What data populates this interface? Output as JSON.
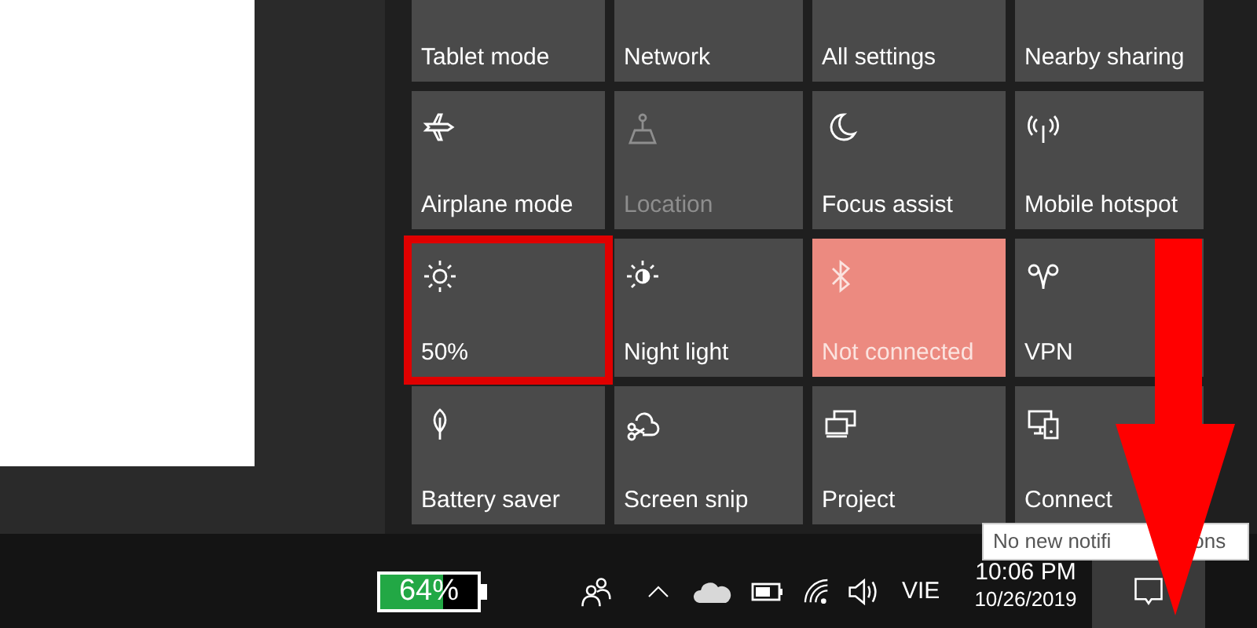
{
  "quick_actions": [
    {
      "label": "Tablet mode",
      "on": false,
      "disabled": false
    },
    {
      "label": "Network",
      "on": false,
      "disabled": false
    },
    {
      "label": "All settings",
      "on": false,
      "disabled": false
    },
    {
      "label": "Nearby sharing",
      "on": false,
      "disabled": false
    },
    {
      "label": "Airplane mode",
      "on": false,
      "disabled": false
    },
    {
      "label": "Location",
      "on": false,
      "disabled": true
    },
    {
      "label": "Focus assist",
      "on": false,
      "disabled": false
    },
    {
      "label": "Mobile hotspot",
      "on": false,
      "disabled": false
    },
    {
      "label": "50%",
      "on": false,
      "disabled": false
    },
    {
      "label": "Night light",
      "on": false,
      "disabled": false
    },
    {
      "label": "Not connected",
      "on": true,
      "disabled": false
    },
    {
      "label": "VPN",
      "on": false,
      "disabled": false
    },
    {
      "label": "Battery saver",
      "on": false,
      "disabled": false
    },
    {
      "label": "Screen snip",
      "on": false,
      "disabled": false
    },
    {
      "label": "Project",
      "on": false,
      "disabled": false
    },
    {
      "label": "Connect",
      "on": false,
      "disabled": false
    }
  ],
  "tooltip": {
    "parts": [
      "No new notifi",
      "ons"
    ]
  },
  "taskbar": {
    "battery_widget": {
      "reading": "64%",
      "level": 0.64
    },
    "language": "VIE",
    "time": "10:06 PM",
    "date": "10/26/2019"
  }
}
